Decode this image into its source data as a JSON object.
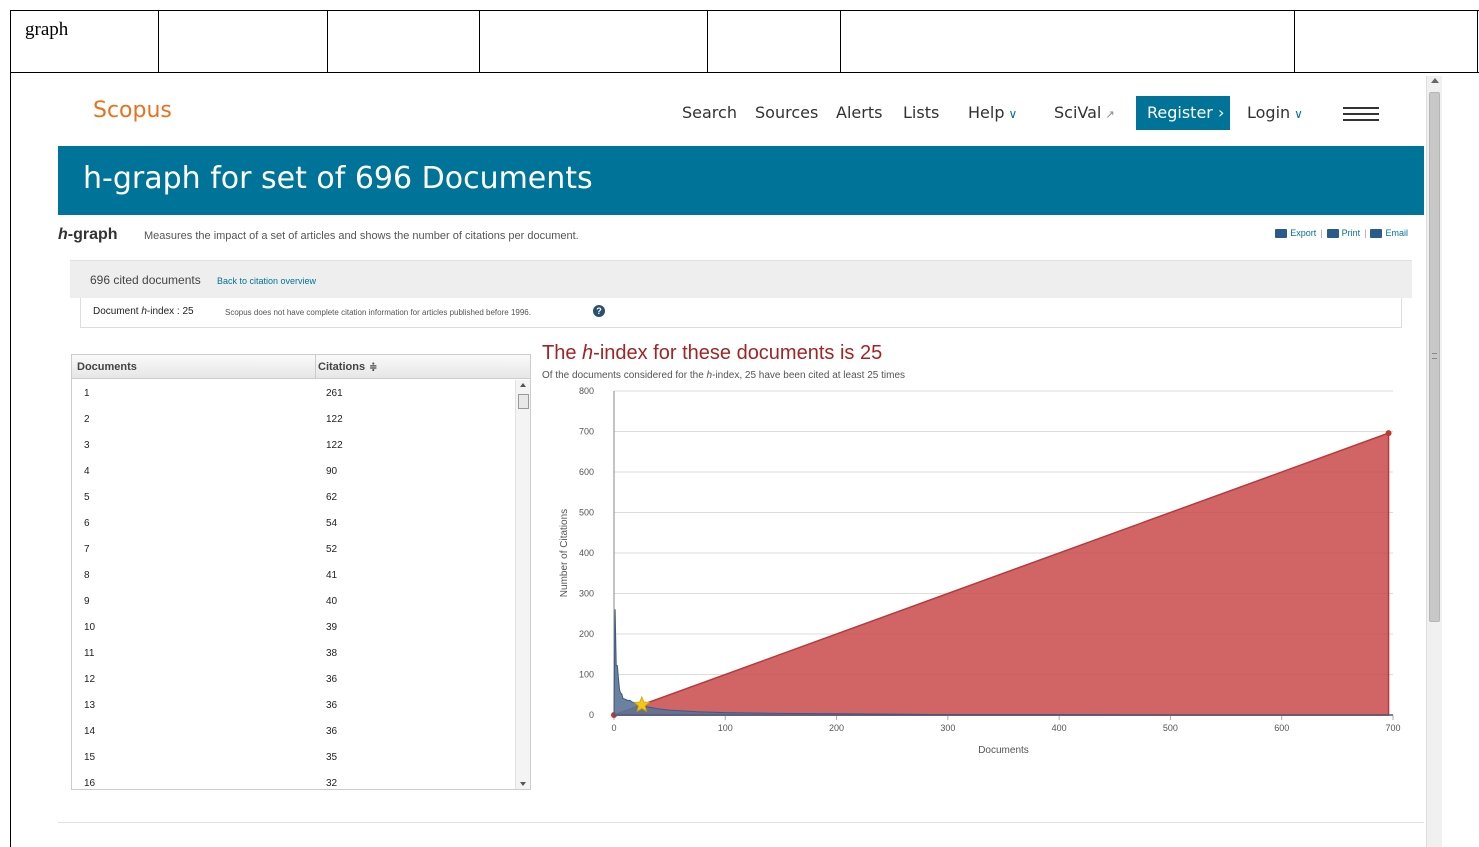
{
  "outer": {
    "cell_text": "graph"
  },
  "header": {
    "logo": "Scopus",
    "nav": {
      "search": "Search",
      "sources": "Sources",
      "alerts": "Alerts",
      "lists": "Lists",
      "help": "Help",
      "scival": "SciVal",
      "register": "Register",
      "login": "Login"
    },
    "chevron": "∨",
    "external": "↗",
    "register_arrow": "›"
  },
  "banner": {
    "title": "h-graph for set of 696 Documents"
  },
  "subheader": {
    "label_italic": "h",
    "label_rest": "-graph",
    "description": "Measures the impact of a set of articles and shows the number of citations per document.",
    "export": "Export",
    "print": "Print",
    "email": "Email"
  },
  "citations_box": {
    "count": "696 cited documents",
    "back": "Back to citation overview",
    "hindex_prefix": "Document ",
    "hindex_italic": "h",
    "hindex_suffix": "-index : 25",
    "note": "Scopus does not have complete citation information for articles published before 1996.",
    "help": "?"
  },
  "table": {
    "col_documents": "Documents",
    "col_citations": "Citations",
    "sort_icon": "≑",
    "rows": [
      {
        "doc": "1",
        "cit": "261"
      },
      {
        "doc": "2",
        "cit": "122"
      },
      {
        "doc": "3",
        "cit": "122"
      },
      {
        "doc": "4",
        "cit": "90"
      },
      {
        "doc": "5",
        "cit": "62"
      },
      {
        "doc": "6",
        "cit": "54"
      },
      {
        "doc": "7",
        "cit": "52"
      },
      {
        "doc": "8",
        "cit": "41"
      },
      {
        "doc": "9",
        "cit": "40"
      },
      {
        "doc": "10",
        "cit": "39"
      },
      {
        "doc": "11",
        "cit": "38"
      },
      {
        "doc": "12",
        "cit": "36"
      },
      {
        "doc": "13",
        "cit": "36"
      },
      {
        "doc": "14",
        "cit": "36"
      },
      {
        "doc": "15",
        "cit": "35"
      },
      {
        "doc": "16",
        "cit": "32"
      }
    ]
  },
  "chart": {
    "title_pre": "The ",
    "title_italic": "h",
    "title_post": "-index for these documents is 25",
    "subtitle_pre": "Of the documents considered for the ",
    "subtitle_italic": "h",
    "subtitle_post": "-index, 25 have been cited at least 25 times"
  },
  "chart_data": {
    "type": "area",
    "xlabel": "Documents",
    "ylabel": "Number of Citations",
    "xlim": [
      0,
      700
    ],
    "ylim": [
      0,
      800
    ],
    "xticks": [
      0,
      100,
      200,
      300,
      400,
      500,
      600,
      700
    ],
    "yticks": [
      0,
      100,
      200,
      300,
      400,
      500,
      600,
      700,
      800
    ],
    "grid": true,
    "series": [
      {
        "kind": "reference-line",
        "color": "#c94a4a",
        "points": [
          [
            0,
            0
          ],
          [
            696,
            696
          ]
        ]
      },
      {
        "kind": "citations",
        "color": "#5b7396",
        "points": [
          [
            1,
            261
          ],
          [
            2,
            122
          ],
          [
            3,
            122
          ],
          [
            4,
            90
          ],
          [
            5,
            62
          ],
          [
            6,
            54
          ],
          [
            7,
            52
          ],
          [
            8,
            41
          ],
          [
            9,
            40
          ],
          [
            10,
            39
          ],
          [
            11,
            38
          ],
          [
            12,
            36
          ],
          [
            13,
            36
          ],
          [
            14,
            36
          ],
          [
            15,
            35
          ],
          [
            16,
            32
          ],
          [
            20,
            30
          ],
          [
            25,
            25
          ],
          [
            30,
            20
          ],
          [
            40,
            15
          ],
          [
            50,
            12
          ],
          [
            75,
            8
          ],
          [
            100,
            6
          ],
          [
            150,
            4
          ],
          [
            200,
            3
          ],
          [
            300,
            1
          ],
          [
            400,
            1
          ],
          [
            500,
            0
          ],
          [
            696,
            0
          ]
        ]
      }
    ],
    "h_index_marker": {
      "x": 25,
      "y": 25,
      "color": "#f5c518"
    }
  }
}
